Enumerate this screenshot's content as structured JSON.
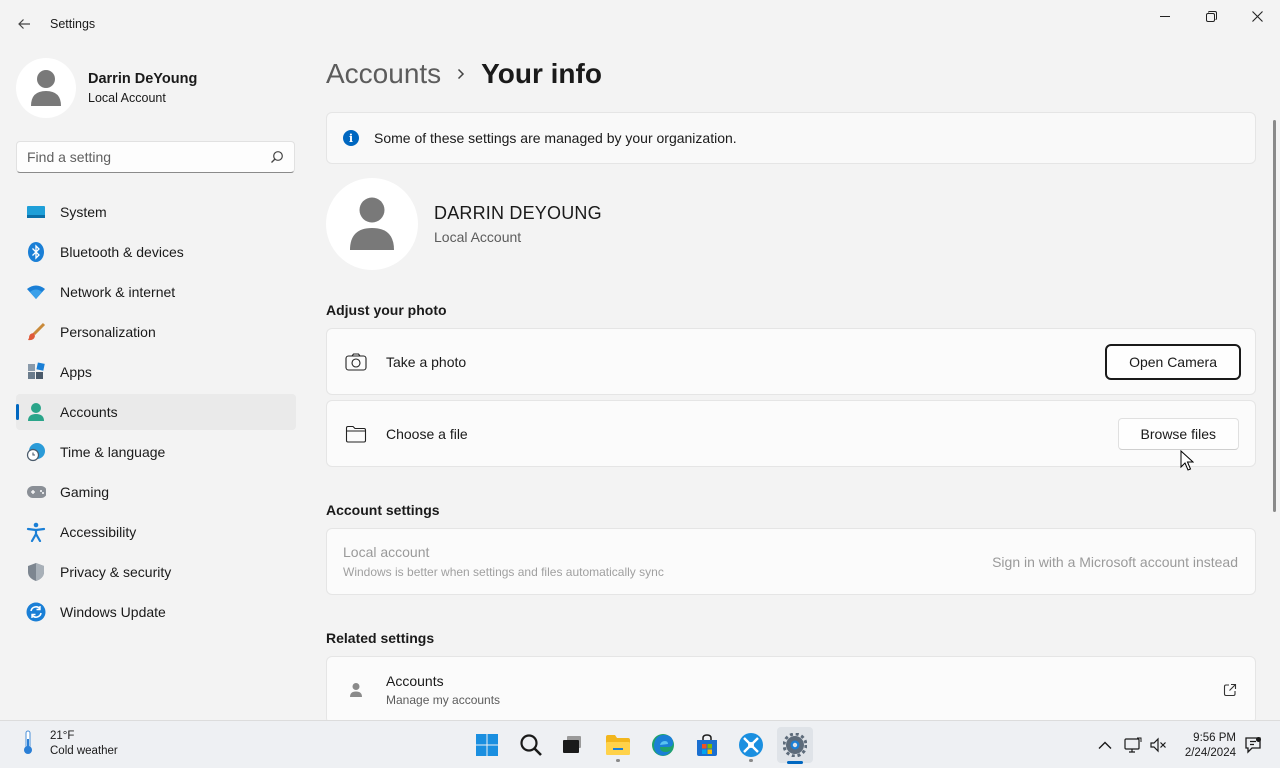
{
  "window": {
    "title": "Settings"
  },
  "sidebar": {
    "profile": {
      "name": "Darrin DeYoung",
      "account_type": "Local Account"
    },
    "search": {
      "placeholder": "Find a setting"
    },
    "items": [
      {
        "label": "System",
        "icon": "system-icon"
      },
      {
        "label": "Bluetooth & devices",
        "icon": "bluetooth-icon"
      },
      {
        "label": "Network & internet",
        "icon": "wifi-icon"
      },
      {
        "label": "Personalization",
        "icon": "brush-icon"
      },
      {
        "label": "Apps",
        "icon": "apps-icon"
      },
      {
        "label": "Accounts",
        "icon": "accounts-icon",
        "active": true
      },
      {
        "label": "Time & language",
        "icon": "globe-clock-icon"
      },
      {
        "label": "Gaming",
        "icon": "gamepad-icon"
      },
      {
        "label": "Accessibility",
        "icon": "accessibility-icon"
      },
      {
        "label": "Privacy & security",
        "icon": "shield-icon"
      },
      {
        "label": "Windows Update",
        "icon": "update-icon"
      }
    ]
  },
  "main": {
    "breadcrumb": {
      "parent": "Accounts",
      "current": "Your info"
    },
    "info_banner": "Some of these settings are managed by your organization.",
    "user": {
      "name": "DARRIN DEYOUNG",
      "account_type": "Local Account"
    },
    "adjust_photo": {
      "title": "Adjust your photo",
      "take_photo": {
        "label": "Take a photo",
        "button": "Open Camera"
      },
      "choose_file": {
        "label": "Choose a file",
        "button": "Browse files"
      }
    },
    "account_settings": {
      "title": "Account settings",
      "local_account": {
        "title": "Local account",
        "subtitle": "Windows is better when settings and files automatically sync",
        "link": "Sign in with a Microsoft account instead"
      }
    },
    "related_settings": {
      "title": "Related settings",
      "accounts": {
        "title": "Accounts",
        "subtitle": "Manage my accounts"
      }
    }
  },
  "taskbar": {
    "weather": {
      "temp": "21°F",
      "condition": "Cold weather"
    },
    "clock": {
      "time": "9:56 PM",
      "date": "2/24/2024"
    }
  },
  "colors": {
    "accent": "#0067c0",
    "background": "#f3f3f3",
    "card": "#fbfbfb"
  }
}
